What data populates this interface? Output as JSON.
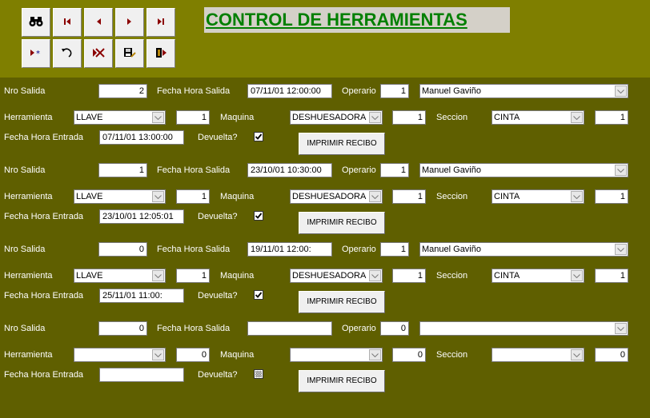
{
  "form": {
    "title": "CONTROL DE HERRAMIENTAS"
  },
  "toolbar": {
    "buttons": [
      {
        "icon": "binoculars-icon",
        "name": "find-button"
      },
      {
        "icon": "first-record-icon",
        "name": "first-record-button"
      },
      {
        "icon": "previous-record-icon",
        "name": "previous-record-button"
      },
      {
        "icon": "next-record-icon",
        "name": "next-record-button"
      },
      {
        "icon": "last-record-icon",
        "name": "last-record-button"
      },
      {
        "icon": "new-record-icon",
        "name": "new-record-button"
      },
      {
        "icon": "undo-icon",
        "name": "undo-button"
      },
      {
        "icon": "delete-record-icon",
        "name": "delete-record-button"
      },
      {
        "icon": "save-record-icon",
        "name": "save-record-button"
      },
      {
        "icon": "exit-icon",
        "name": "exit-button"
      }
    ]
  },
  "labels": {
    "nro_salida": "Nro Salida",
    "fecha_hora_salida": "Fecha Hora Salida",
    "operario": "Operario",
    "herramienta": "Herramienta",
    "maquina": "Maquina",
    "seccion": "Seccion",
    "fecha_hora_entrada": "Fecha Hora Entrada",
    "devuelta": "Devuelta?",
    "imprimir": "IMPRIMIR RECIBO"
  },
  "records": [
    {
      "nro_salida": "2",
      "fecha_salida": "07/11/01 12:00:00",
      "operario_id": "1",
      "operario_nombre": "Manuel Gaviño",
      "herramienta": "LLAVE",
      "herramienta_id": "1",
      "maquina": "DESHUESADORA",
      "maquina_id": "1",
      "seccion": "CINTA",
      "seccion_id": "1",
      "fecha_entrada": "07/11/01 13:00:00",
      "devuelta": "checked"
    },
    {
      "nro_salida": "1",
      "fecha_salida": "23/10/01 10:30:00",
      "operario_id": "1",
      "operario_nombre": "Manuel Gaviño",
      "herramienta": "LLAVE",
      "herramienta_id": "1",
      "maquina": "DESHUESADORA",
      "maquina_id": "1",
      "seccion": "CINTA",
      "seccion_id": "1",
      "fecha_entrada": "23/10/01 12:05:01",
      "devuelta": "checked"
    },
    {
      "nro_salida": "0",
      "fecha_salida": "19/11/01 12:00:",
      "operario_id": "1",
      "operario_nombre": "Manuel Gaviño",
      "herramienta": "LLAVE",
      "herramienta_id": "1",
      "maquina": "DESHUESADORA",
      "maquina_id": "1",
      "seccion": "CINTA",
      "seccion_id": "1",
      "fecha_entrada": "25/11/01 11:00:",
      "devuelta": "checked"
    },
    {
      "nro_salida": "0",
      "fecha_salida": "",
      "operario_id": "0",
      "operario_nombre": "",
      "herramienta": "",
      "herramienta_id": "0",
      "maquina": "",
      "maquina_id": "0",
      "seccion": "",
      "seccion_id": "0",
      "fecha_entrada": "",
      "devuelta": "indeterminate"
    }
  ]
}
